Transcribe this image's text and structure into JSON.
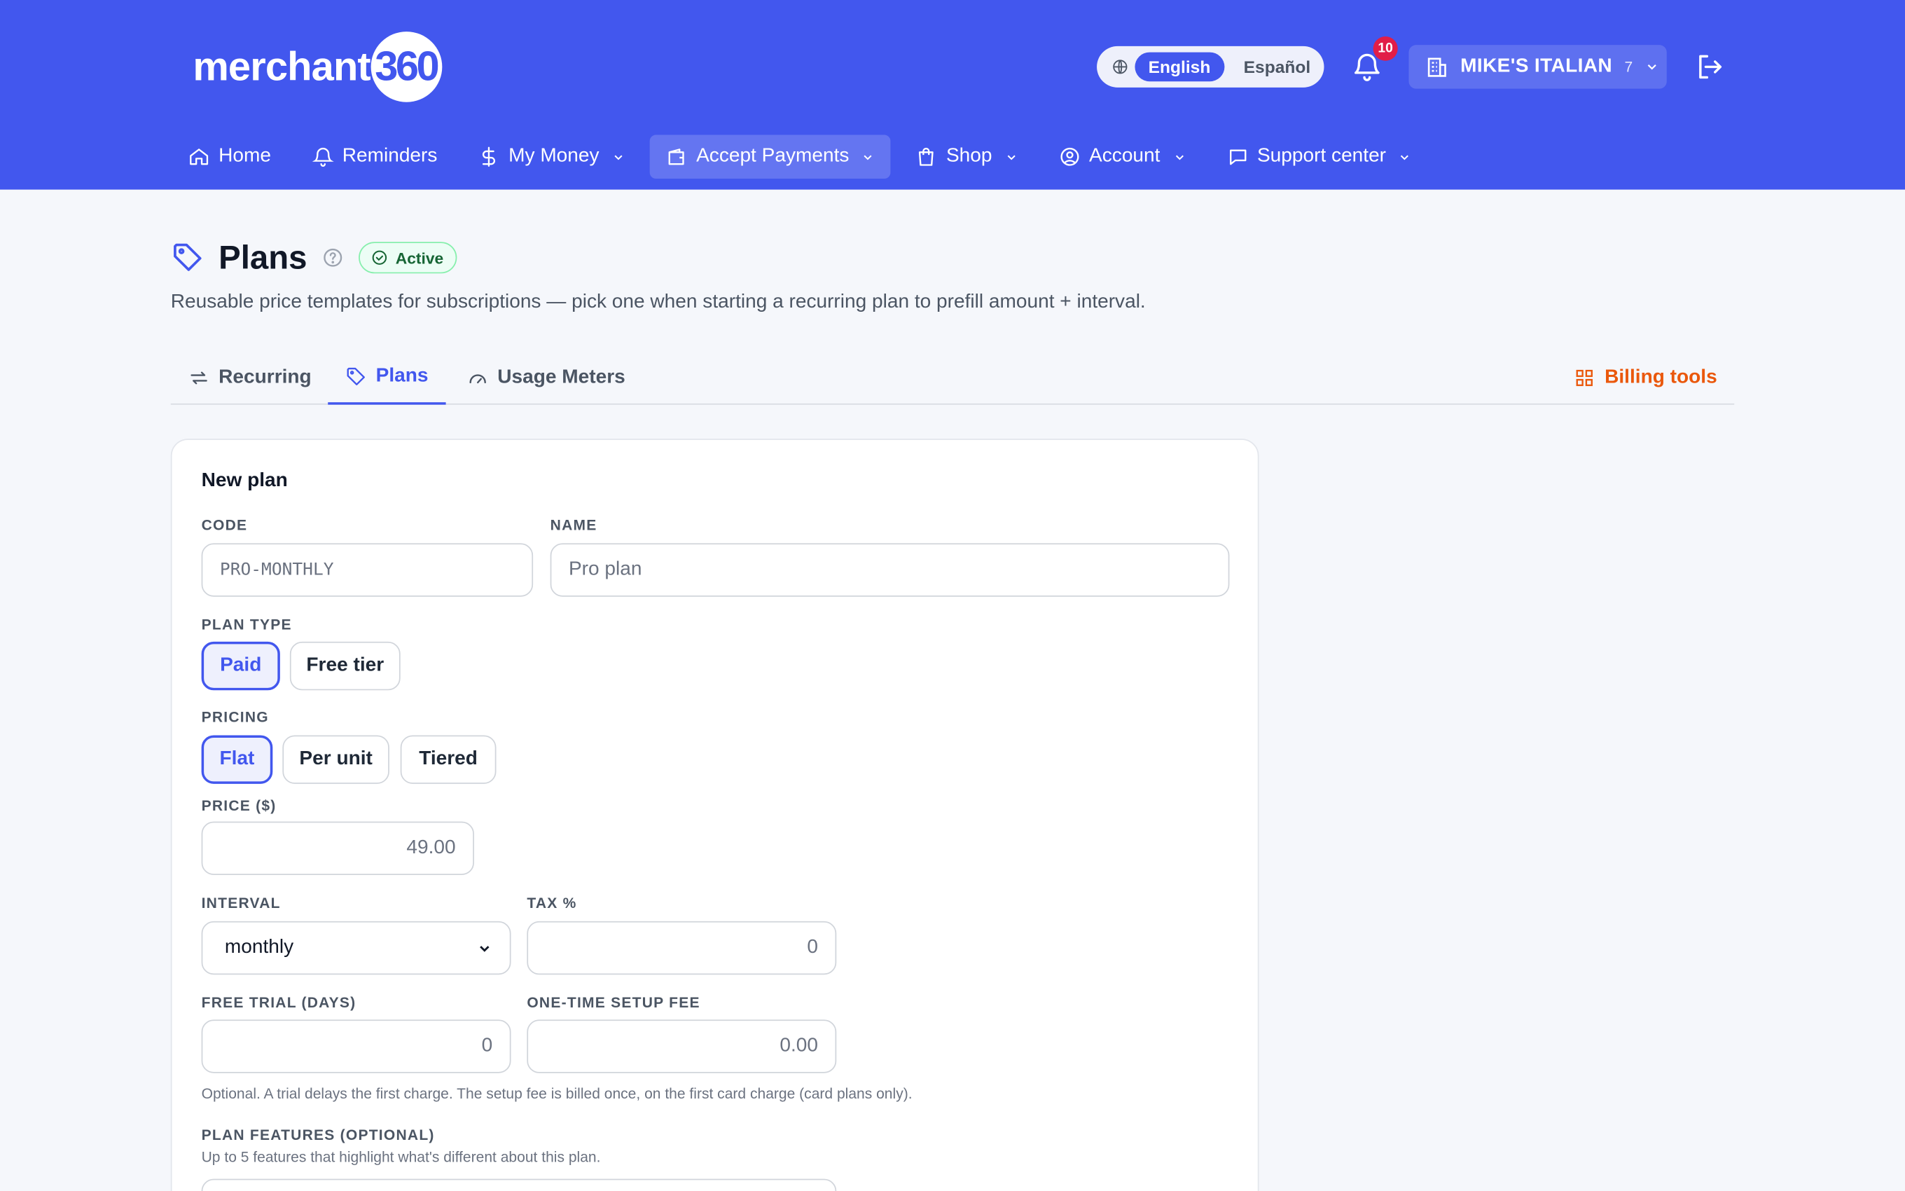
{
  "brand": {
    "wordmark": "merchant",
    "number": "360"
  },
  "language": {
    "icon": "globe-icon",
    "options": [
      "English",
      "Español"
    ],
    "selected": "English"
  },
  "notifications": {
    "icon": "bell-icon",
    "count": "10"
  },
  "merchant": {
    "icon": "building-icon",
    "name": "MIKE'S ITALIAN",
    "count": "7"
  },
  "nav": {
    "items": [
      {
        "label": "Home",
        "icon": "home-icon"
      },
      {
        "label": "Reminders",
        "icon": "bell-icon"
      },
      {
        "label": "My Money",
        "icon": "dollar-icon"
      },
      {
        "label": "Accept Payments",
        "icon": "wallet-icon",
        "active": true
      },
      {
        "label": "Shop",
        "icon": "bag-icon"
      },
      {
        "label": "Account",
        "icon": "user-circle-icon"
      },
      {
        "label": "Support center",
        "icon": "chat-icon"
      }
    ]
  },
  "page": {
    "title": "Plans",
    "status": "Active",
    "subtitle": "Reusable price templates for subscriptions — pick one when starting a recurring plan to prefill amount + interval."
  },
  "tabs": [
    {
      "label": "Recurring",
      "icon": "repeat-icon"
    },
    {
      "label": "Plans",
      "icon": "tag-icon",
      "active": true
    },
    {
      "label": "Usage Meters",
      "icon": "gauge-icon"
    }
  ],
  "billing_tools": "Billing tools",
  "form": {
    "heading": "New plan",
    "code": {
      "label": "CODE",
      "placeholder": "PRO-MONTHLY"
    },
    "name": {
      "label": "NAME",
      "placeholder": "Pro plan"
    },
    "plan_type": {
      "label": "PLAN TYPE",
      "options": [
        "Paid",
        "Free tier"
      ],
      "selected": "Paid"
    },
    "pricing": {
      "label": "PRICING",
      "options": [
        "Flat",
        "Per unit",
        "Tiered"
      ],
      "selected": "Flat"
    },
    "price": {
      "label": "PRICE ($)",
      "value": "49.00"
    },
    "interval": {
      "label": "INTERVAL",
      "value": "monthly"
    },
    "tax": {
      "label": "TAX %",
      "value": "0"
    },
    "trial": {
      "label": "FREE TRIAL (DAYS)",
      "value": "0"
    },
    "setup_fee": {
      "label": "ONE-TIME SETUP FEE",
      "value": "0.00"
    },
    "hint": "Optional. A trial delays the first charge. The setup fee is billed once, on the first card charge (card plans only).",
    "features": {
      "label": "PLAN FEATURES (OPTIONAL)",
      "hint": "Up to 5 features that highlight what's different about this plan."
    }
  },
  "colors": {
    "header": "#4257ee",
    "accent": "#4257ee",
    "billing": "#ea580c",
    "badge": "#e11d48",
    "success": "#166534"
  }
}
